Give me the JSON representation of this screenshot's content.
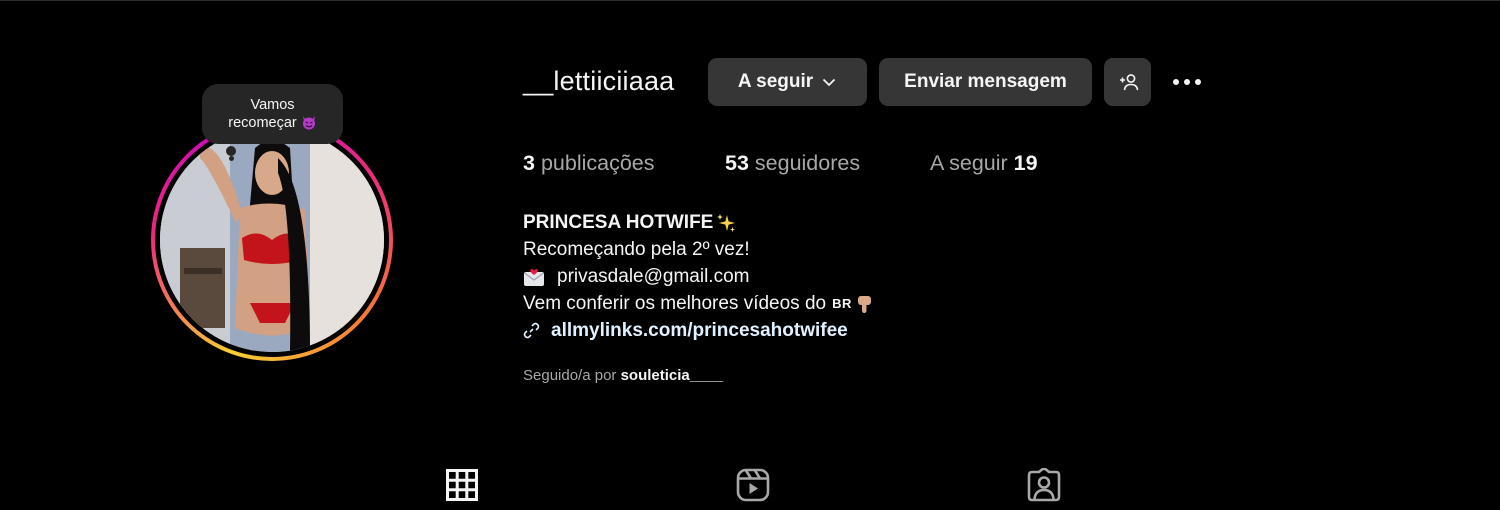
{
  "profile": {
    "username": "__lettiiciiaaa",
    "note_line1": "Vamos",
    "note_line2": "recomeçar",
    "note_emoji": "devil-emoji-icon",
    "avatar_alt": "profile photo"
  },
  "actions": {
    "following_label": "A seguir",
    "message_label": "Enviar mensagem",
    "suggest_icon": "add-person-icon",
    "more_icon": "more-options-icon"
  },
  "stats": {
    "posts_count": "3",
    "posts_label": "publicações",
    "followers_count": "53",
    "followers_label": "seguidores",
    "following_label": "A seguir",
    "following_count": "19"
  },
  "bio": {
    "name": "PRINCESA HOTWIFE",
    "line2": "Recomeçando pela 2º vez!",
    "email": "privasdale@gmail.com",
    "line4": "Vem conferir os melhores vídeos do",
    "flag_text": "BR",
    "link": "allmylinks.com/princesahotwifee"
  },
  "followed_by": {
    "prefix": "Seguido/a por",
    "user": "souleticia____"
  },
  "tabs": [
    {
      "name": "posts",
      "icon": "grid-icon"
    },
    {
      "name": "reels",
      "icon": "reels-icon"
    },
    {
      "name": "tagged",
      "icon": "tagged-icon"
    }
  ],
  "colors": {
    "background": "#000000",
    "button": "#363636",
    "text_secondary": "#a8a8a8",
    "link": "#e0f1ff"
  }
}
